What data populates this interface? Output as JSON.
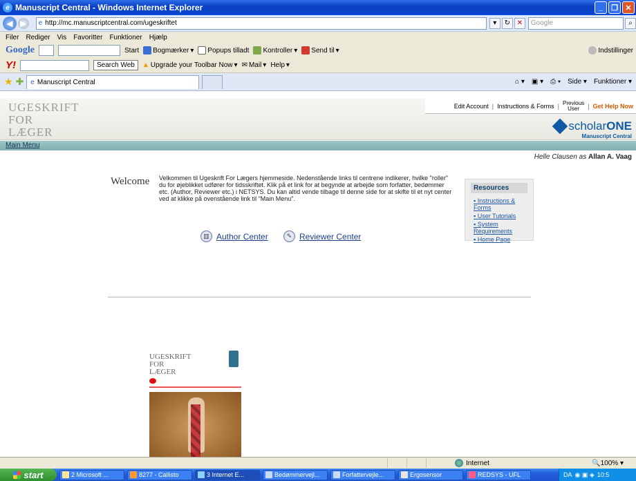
{
  "window": {
    "title": "Manuscript Central - Windows Internet Explorer"
  },
  "address": {
    "url": "http://mc.manuscriptcentral.com/ugeskriftet",
    "search_placeholder": "Google"
  },
  "menubar": [
    "Filer",
    "Rediger",
    "Vis",
    "Favoritter",
    "Funktioner",
    "Hjælp"
  ],
  "google_toolbar": {
    "logo": "Google",
    "start": "Start",
    "bookmarks": "Bogmærker",
    "popups": "Popups tilladt",
    "check": "Kontroller",
    "send": "Send til",
    "settings": "Indstillinger"
  },
  "yahoo_toolbar": {
    "logo": "Y!",
    "search_web": "Search Web",
    "upgrade": "Upgrade your Toolbar Now",
    "mail": "Mail",
    "help": "Help"
  },
  "tabs": {
    "active": "Manuscript Central",
    "page_menu": "Side",
    "tools_menu": "Funktioner"
  },
  "header": {
    "brand_line1": "UGESKRIFT",
    "brand_line2": "FOR",
    "brand_line3": "LÆGER",
    "edit_account": "Edit Account",
    "instructions": "Instructions & Forms",
    "previous_line1": "Previous",
    "previous_line2": "User",
    "get_help": "Get Help Now",
    "logo_light": "scholar",
    "logo_bold": "ONE",
    "logo_sub": "Manuscript Central"
  },
  "main_menu": "Main Menu",
  "user": {
    "name": "Helle Clausen",
    "as_text": "as",
    "role_user": "Allan A. Vaag"
  },
  "welcome": {
    "label": "Welcome",
    "text": "Velkommen til Ugeskrift For Lægers hjemmeside. Nedenstående links til centrene indikerer, hvilke \"roller\" du for øjeblikket udfører for tidsskriftet. Klik på et link for at begynde at arbejde som forfatter, bedømmer etc. (Author, Reviewer etc.) i NETSYS. Du kan altid vende tilbage til denne side for at skifte til et nyt center ved at klikke på ovenstående link til \"Main Menu\"."
  },
  "resources": {
    "title": "Resources",
    "items": [
      "Instructions & Forms",
      "User Tutorials",
      "System Requirements",
      "Home Page"
    ]
  },
  "centers": {
    "author": "Author Center",
    "reviewer": "Reviewer Center"
  },
  "cover": {
    "line1": "UGESKRIFT",
    "line2": "FOR",
    "line3": "LÆGER"
  },
  "statusbar": {
    "zone": "Internet",
    "zoom": "100%"
  },
  "taskbar": {
    "start": "start",
    "tasks": [
      "2 Microsoft ...",
      "8277 - Callisto",
      "3 Internet E...",
      "Bedømmervejl...",
      "Forfattervejle...",
      "Ergosensor",
      "REDSYS - UFL"
    ],
    "lang": "DA",
    "time": "10:5"
  }
}
